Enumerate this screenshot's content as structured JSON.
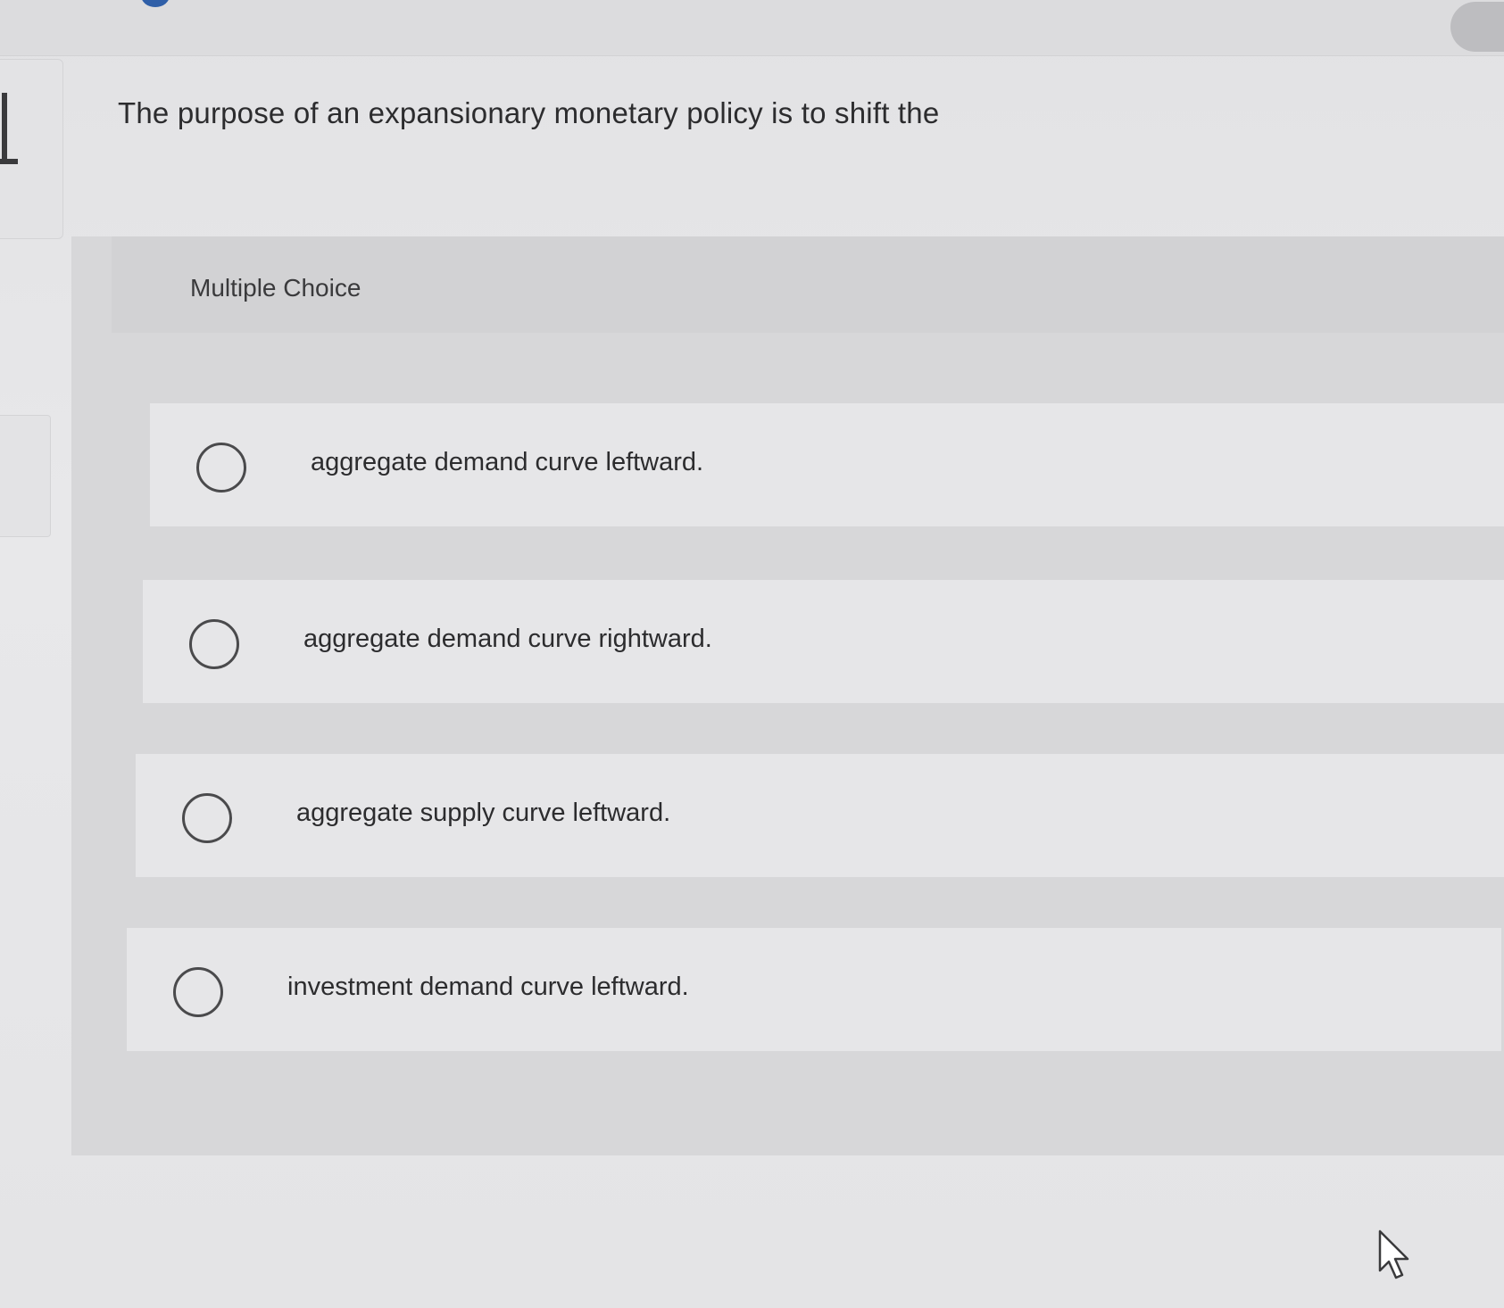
{
  "question": {
    "text": "The purpose of an expansionary monetary policy is to shift the"
  },
  "multiple_choice": {
    "label": "Multiple Choice",
    "options": [
      {
        "text": "aggregate demand curve leftward.",
        "selected": false
      },
      {
        "text": "aggregate demand curve rightward.",
        "selected": false
      },
      {
        "text": "aggregate supply curve leftward.",
        "selected": false
      },
      {
        "text": "investment demand curve leftward.",
        "selected": false
      }
    ]
  },
  "icons": {
    "radio": "radio-button-icon",
    "cursor": "mouse-pointer-icon"
  },
  "colors": {
    "background": "#e6e6e8",
    "panel": "#d7d7d9",
    "option_bg": "#e6e6e8",
    "text": "#2c2c2e"
  }
}
